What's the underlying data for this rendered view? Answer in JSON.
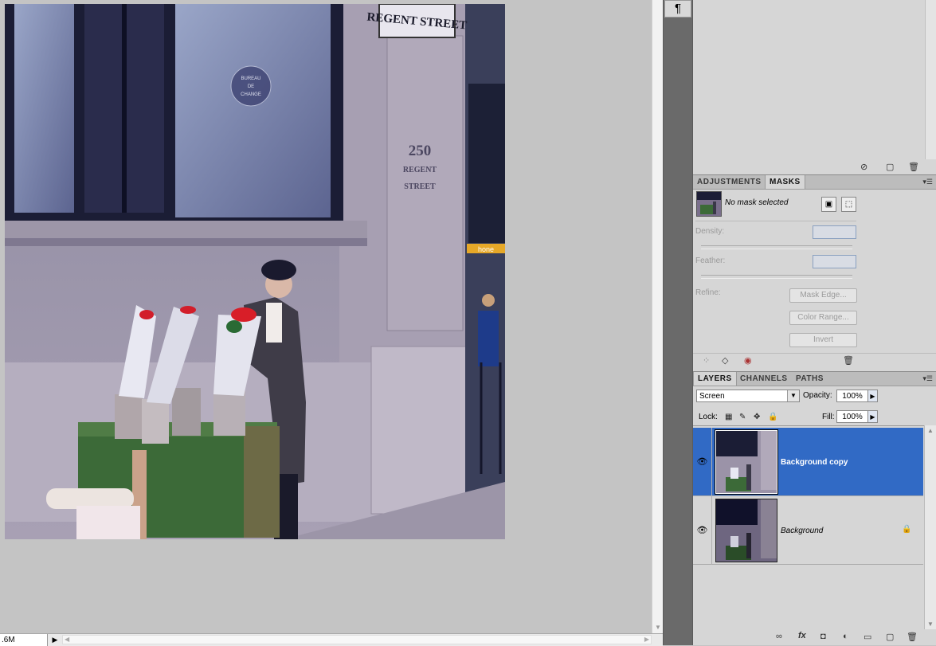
{
  "status_bar": {
    "doc_size": ".6M",
    "menu_arrow": "▶"
  },
  "image": {
    "sign_street": "REGENT STREET",
    "door_sign_line1": "BUREAU",
    "door_sign_line2": "DE",
    "door_sign_line3": "CHANGE",
    "address_number": "250",
    "address_line2": "REGENT",
    "address_line3": "STREET",
    "shop_sign": "hone"
  },
  "dock": {
    "paragraph_icon": "¶"
  },
  "masks_panel": {
    "tabs": [
      "ADJUSTMENTS",
      "MASKS"
    ],
    "active_tab": "MASKS",
    "no_mask": "No mask selected",
    "density_label": "Density:",
    "feather_label": "Feather:",
    "refine_label": "Refine:",
    "mask_edge_button": "Mask Edge...",
    "color_range_button": "Color Range...",
    "invert_button": "Invert"
  },
  "layers_panel": {
    "tabs": [
      "LAYERS",
      "CHANNELS",
      "PATHS"
    ],
    "active_tab": "LAYERS",
    "blend_mode": "Screen",
    "opacity_label": "Opacity:",
    "opacity_value": "100%",
    "lock_label": "Lock:",
    "fill_label": "Fill:",
    "fill_value": "100%",
    "layers": [
      {
        "name": "Background copy",
        "selected": true,
        "locked": false
      },
      {
        "name": "Background",
        "selected": false,
        "locked": true
      }
    ],
    "selected_color": "#316ac5"
  },
  "icons": {
    "panel_menu": "panel-menu-icon",
    "eye": "eye-icon",
    "lock": "lock-icon",
    "trash": "trash-icon",
    "link": "link-layers-icon",
    "fx": "fx-icon",
    "mask": "add-mask-icon",
    "adjustment": "adjustment-layer-icon",
    "group": "folder-icon",
    "new_layer": "new-layer-icon"
  }
}
